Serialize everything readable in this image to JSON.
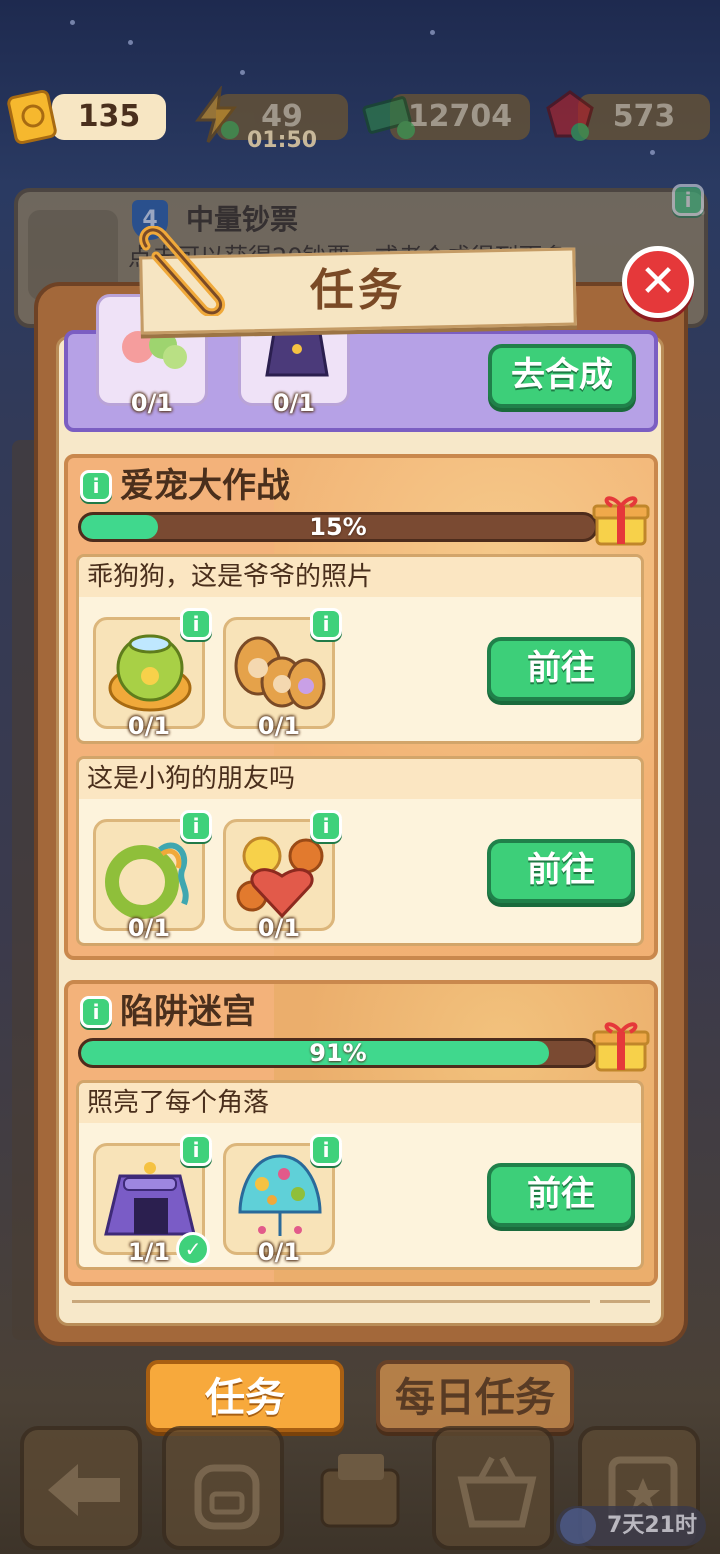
{
  "resources": {
    "tickets": "135",
    "energy": "49",
    "energy_timer": "01:50",
    "cash": "12704",
    "gems": "573"
  },
  "background_tip": {
    "level": "4",
    "title": "中量钞票",
    "desc": "点击可以获得20钞票，或者合成得到更多"
  },
  "dialog": {
    "title": "任务",
    "close_icon": "close-icon"
  },
  "top_card": {
    "items": [
      {
        "count": "0/1",
        "icon": "flower-plate-icon"
      },
      {
        "count": "0/1",
        "icon": "wizard-robe-icon"
      }
    ],
    "button": "去合成"
  },
  "quests": [
    {
      "title": "爱宠大作战",
      "progress": 0.15,
      "progress_label": "15%",
      "tasks": [
        {
          "title": "乖狗狗，这是爷爷的照片",
          "items": [
            {
              "count": "0/1",
              "icon": "pet-bowl-icon"
            },
            {
              "count": "0/1",
              "icon": "photo-frames-icon"
            }
          ],
          "button": "前往"
        },
        {
          "title": "这是小狗的朋友吗",
          "items": [
            {
              "count": "0/1",
              "icon": "rope-ring-toy-icon"
            },
            {
              "count": "0/1",
              "icon": "dog-cookies-icon"
            }
          ],
          "button": "前往"
        }
      ]
    },
    {
      "title": "陷阱迷宫",
      "progress": 0.91,
      "progress_label": "91%",
      "tasks": [
        {
          "title": "照亮了每个角落",
          "items": [
            {
              "count": "1/1",
              "icon": "purple-tent-icon",
              "done": true
            },
            {
              "count": "0/1",
              "icon": "mosaic-lamp-icon"
            }
          ],
          "button": "前往"
        }
      ]
    }
  ],
  "tabs": {
    "tasks": "任务",
    "daily": "每日任务"
  },
  "timer_badge": "7天21时",
  "colors": {
    "accent_green": "#3dcf79",
    "panel_brown": "#a3683a",
    "close_red": "#e5383a",
    "tab_active": "#f7a93c"
  }
}
